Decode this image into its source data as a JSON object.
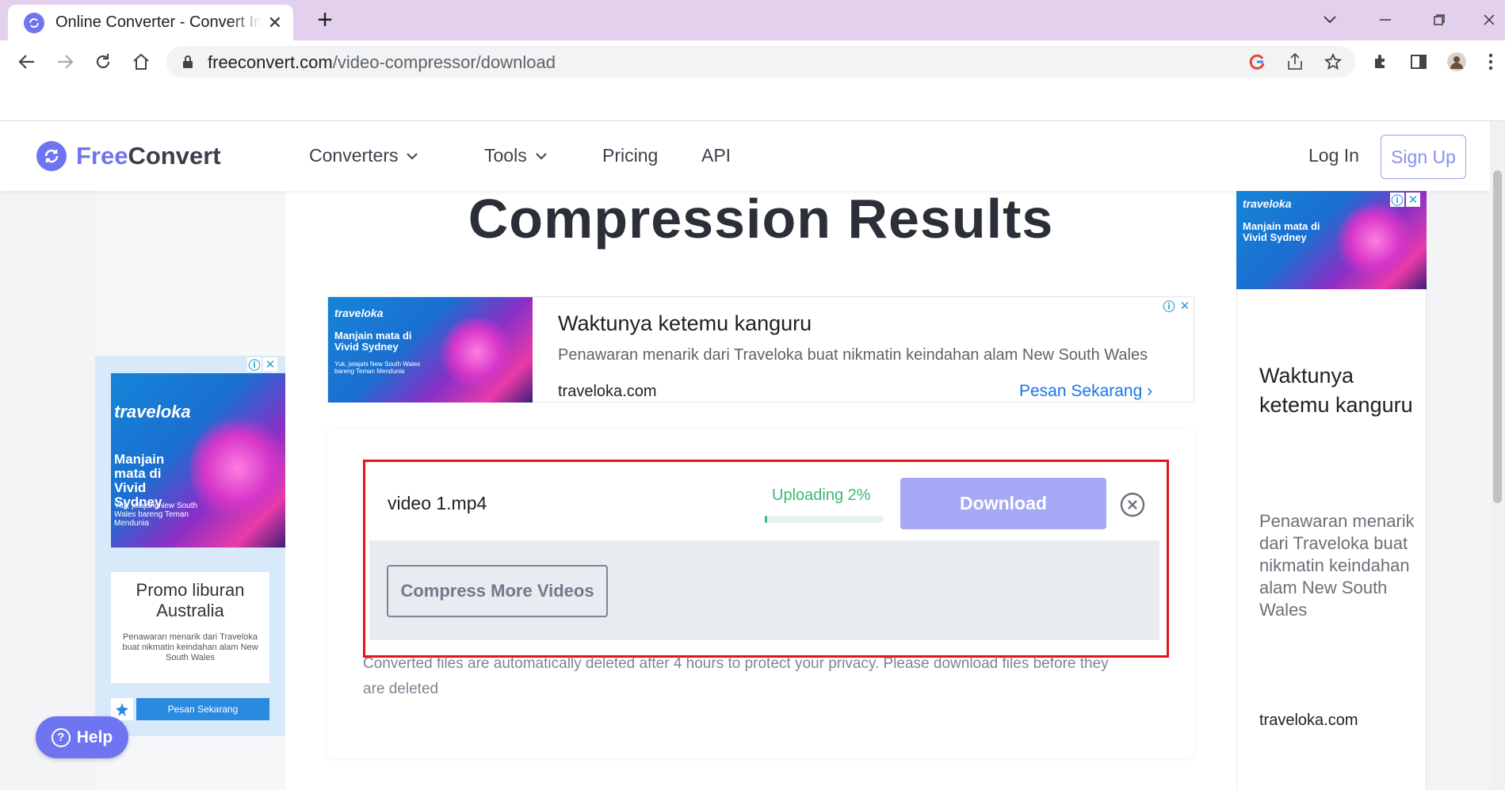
{
  "browser": {
    "tab_title": "Online Converter - Convert Image, Video, Audio",
    "tab_close": "✕",
    "new_tab": "+",
    "url_host": "freeconvert.com",
    "url_path": "/video-compressor/download"
  },
  "site": {
    "logo_part1": "Free",
    "logo_part2": "Convert",
    "nav": {
      "converters": "Converters",
      "tools": "Tools",
      "pricing": "Pricing",
      "api": "API"
    },
    "login": "Log In",
    "signup": "Sign Up",
    "brand_color": "#6f74f0"
  },
  "page": {
    "title": "Compression Results",
    "upload": {
      "filename": "video 1.mp4",
      "status": "Uploading 2%",
      "progress_fraction": 0.02,
      "download_label": "Download",
      "compress_more_label": "Compress More Videos"
    },
    "note": "Converted files are automatically deleted after 4 hours to protect your privacy. Please download files before they are deleted",
    "highlight_color": "#e8101a"
  },
  "top_ad": {
    "image_brand": "traveloka",
    "image_text": "Manjain mata di Vivid Sydney",
    "image_sub": "Yuk, jelajahi New South Wales bareng Teman Mendunia",
    "headline": "Waktunya ketemu kanguru",
    "description": "Penawaran menarik dari Traveloka buat nikmatin keindahan alam New South Wales",
    "domain": "traveloka.com",
    "cta": "Pesan Sekarang"
  },
  "left_ad": {
    "image_brand": "traveloka",
    "image_text": "Manjain mata di Vivid Sydney",
    "image_sub": "Yuk, jelajahi New South Wales bareng Teman Mendunia",
    "title": "Promo liburan Australia",
    "description": "Penawaran menarik dari Traveloka buat nikmatin keindahan alam New South Wales",
    "cta": "Pesan Sekarang"
  },
  "right_ad": {
    "image_brand": "traveloka",
    "image_text": "Manjain mata di Vivid Sydney",
    "headline": "Waktunya ketemu kanguru",
    "description": "Penawaran menarik dari Traveloka buat nikmatin keindahan alam New South Wales",
    "domain": "traveloka.com"
  },
  "help_label": "Help"
}
